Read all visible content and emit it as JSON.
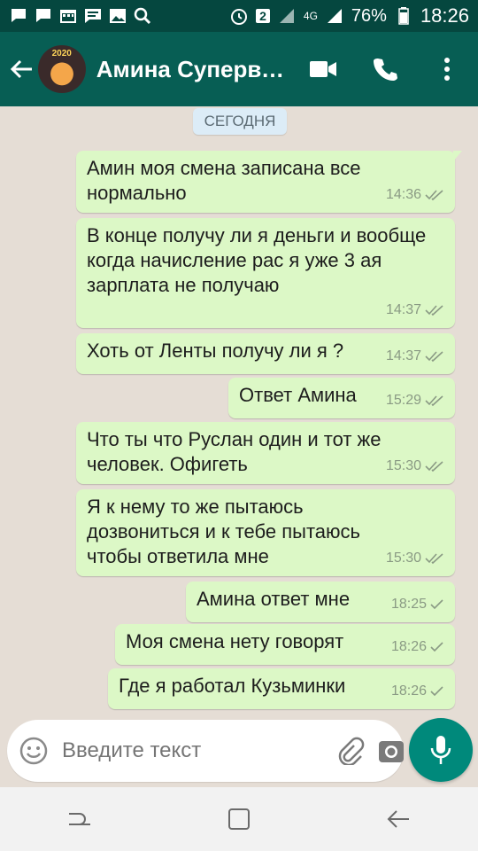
{
  "status_bar": {
    "battery": "76%",
    "time": "18:26",
    "sim_slot": "2",
    "network": "4G",
    "icons": [
      "chat-icon",
      "chat-icon",
      "calendar-icon",
      "message-icon",
      "image-icon",
      "search-icon",
      "alarm-icon",
      "signal-icon",
      "battery-icon"
    ]
  },
  "header": {
    "contact_name": "Амина Суперва…",
    "avatar_caption": "2020",
    "icons": [
      "back-arrow-icon",
      "video-call-icon",
      "phone-icon",
      "more-vert-icon"
    ]
  },
  "chat": {
    "date_label": "СЕГОДНЯ",
    "messages": [
      {
        "text": "Амин моя смена записана все нормально",
        "time": "14:36",
        "status": "read"
      },
      {
        "text": "В конце получу ли я деньги и вообще когда начисление рас я уже 3 ая зарплата не получаю",
        "time": "14:37",
        "status": "read"
      },
      {
        "text": "Хоть от Ленты получу ли я ?",
        "time": "14:37",
        "status": "read"
      },
      {
        "text": "Ответ Амина",
        "time": "15:29",
        "status": "read"
      },
      {
        "text": "Что ты что Руслан один и тот же человек.  Офигеть",
        "time": "15:30",
        "status": "read"
      },
      {
        "text": "Я к нему то же пытаюсь дозвониться и к тебе пытаюсь чтобы ответила мне",
        "time": "15:30",
        "status": "read"
      },
      {
        "text": "Амина ответ мне",
        "time": "18:25",
        "status": "sent"
      },
      {
        "text": "Моя смена нету говорят",
        "time": "18:26",
        "status": "sent"
      },
      {
        "text": "Где я работал Кузьминки",
        "time": "18:26",
        "status": "sent"
      }
    ]
  },
  "composer": {
    "placeholder": "Введите текст",
    "icons": [
      "emoji-icon",
      "attach-icon",
      "camera-icon",
      "mic-icon"
    ]
  },
  "nav": {
    "icons": [
      "recent-apps-icon",
      "home-icon",
      "back-icon"
    ]
  },
  "colors": {
    "status_bar": "#05473f",
    "app_bar": "#075e54",
    "chat_bg": "#e5ddd5",
    "outgoing_bubble": "#dcf8c6",
    "date_pill": "#dcecf7",
    "accent": "#00897b"
  }
}
